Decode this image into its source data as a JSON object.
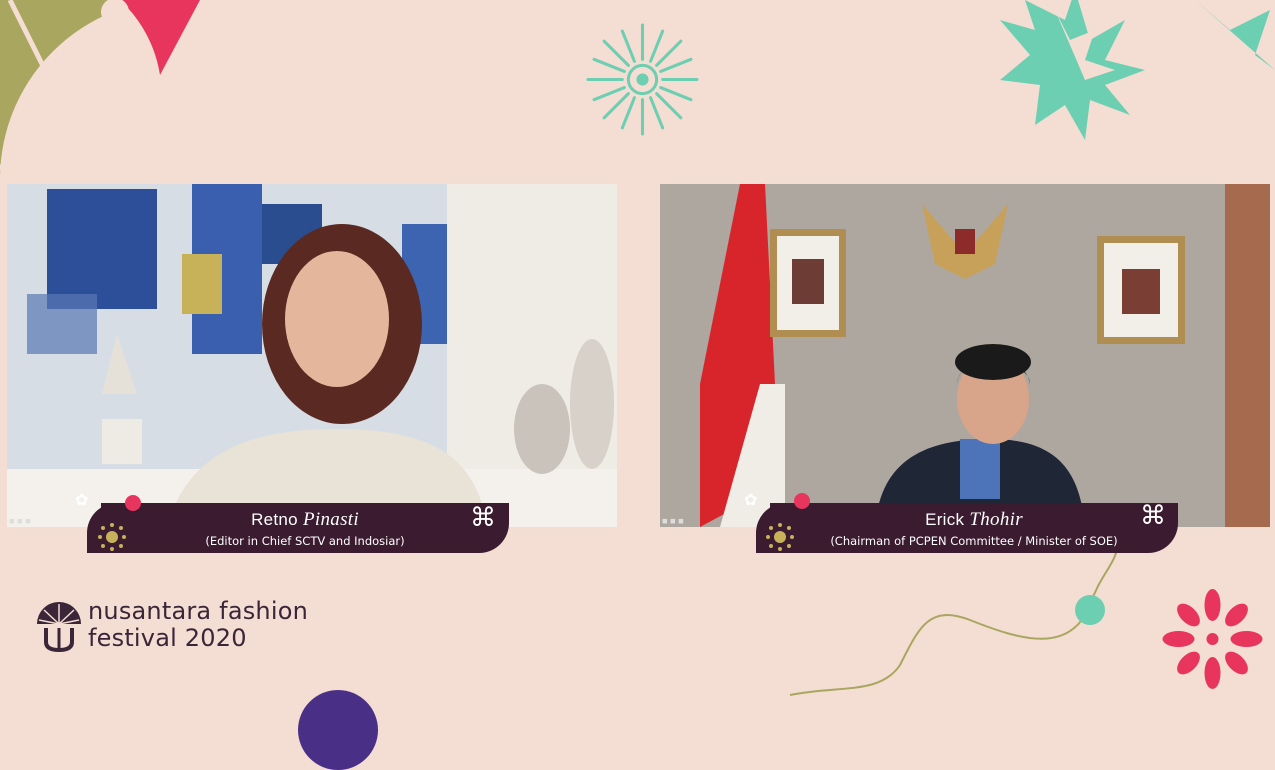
{
  "left_speaker": {
    "first_name": "Retno",
    "last_name": "Pinasti",
    "role": "(Editor in Chief SCTV and Indosiar)"
  },
  "right_speaker": {
    "first_name": "Erick",
    "last_name": "Thohir",
    "role": "(Chairman of PCPEN Committee / Minister of SOE)"
  },
  "event_logo": {
    "line1": "nusantara fashion",
    "line2": "festival 2020"
  },
  "colors": {
    "background": "#f4ddd2",
    "caption_bg": "#3a1b2f",
    "teal": "#6ccfb2",
    "pink": "#e8355e",
    "olive": "#a9a65f"
  }
}
